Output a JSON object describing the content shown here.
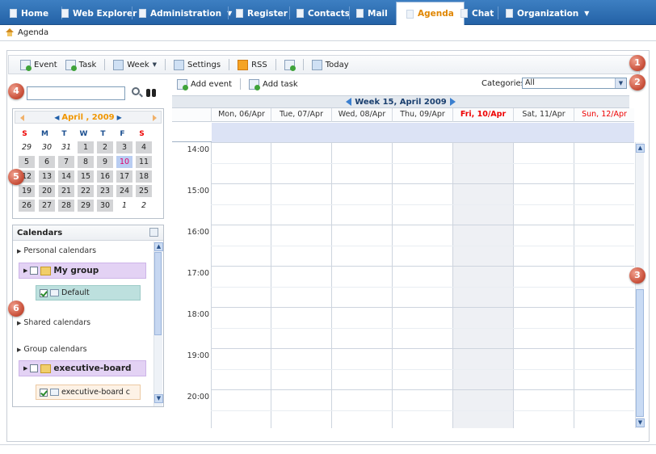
{
  "nav": {
    "tabs": [
      {
        "label": "Home",
        "dropdown": false
      },
      {
        "label": "Web Explorer",
        "dropdown": false
      },
      {
        "label": "Administration",
        "dropdown": true
      },
      {
        "label": "Register",
        "dropdown": false
      },
      {
        "label": "Contacts",
        "dropdown": false
      },
      {
        "label": "Mail",
        "dropdown": false
      },
      {
        "label": "Agenda",
        "dropdown": false,
        "active": true
      },
      {
        "label": "Chat",
        "dropdown": false
      },
      {
        "label": "Organization",
        "dropdown": true
      }
    ]
  },
  "breadcrumb": {
    "label": "Agenda",
    "icon": "home-icon"
  },
  "toolbar": {
    "event_label": "Event",
    "task_label": "Task",
    "week_label": "Week",
    "settings_label": "Settings",
    "rss_label": "RSS",
    "today_label": "Today"
  },
  "search": {
    "value": "",
    "placeholder": ""
  },
  "minical": {
    "month": "April",
    "year": "2009",
    "dow": [
      "S",
      "M",
      "T",
      "W",
      "T",
      "F",
      "S"
    ],
    "weeks": [
      [
        "29",
        "30",
        "31",
        "1",
        "2",
        "3",
        "4"
      ],
      [
        "5",
        "6",
        "7",
        "8",
        "9",
        "10",
        "11"
      ],
      [
        "12",
        "13",
        "14",
        "15",
        "16",
        "17",
        "18"
      ],
      [
        "19",
        "20",
        "21",
        "22",
        "23",
        "24",
        "25"
      ],
      [
        "26",
        "27",
        "28",
        "29",
        "30",
        "1",
        "2"
      ]
    ],
    "today": "10"
  },
  "calendars": {
    "title": "Calendars",
    "personal_label": "Personal calendars",
    "my_group_label": "My group",
    "default_label": "Default",
    "shared_label": "Shared calendars",
    "group_label": "Group calendars",
    "exec_group_label": "executive-board",
    "exec_cal_label": "executive-board c"
  },
  "main": {
    "add_event_label": "Add event",
    "add_task_label": "Add task",
    "categories_label": "Categories:",
    "categories_value": "All",
    "week_title": "Week 15, April 2009",
    "days": [
      "Mon, 06/Apr",
      "Tue, 07/Apr",
      "Wed, 08/Apr",
      "Thu, 09/Apr",
      "Fri, 10/Apr",
      "Sat, 11/Apr",
      "Sun, 12/Apr"
    ],
    "hours": [
      "14:00",
      "15:00",
      "16:00",
      "17:00",
      "18:00",
      "19:00",
      "20:00"
    ]
  },
  "badges": [
    "1",
    "2",
    "3",
    "4",
    "5",
    "6"
  ],
  "colors": {
    "nav_bg": "#2f6fb5",
    "active_tab_text": "#e08600",
    "today_highlight": "#b9cdf2",
    "weekend_red": "#e00000",
    "badge_red": "#c9503a",
    "group_purple": "#e3d2f4"
  }
}
